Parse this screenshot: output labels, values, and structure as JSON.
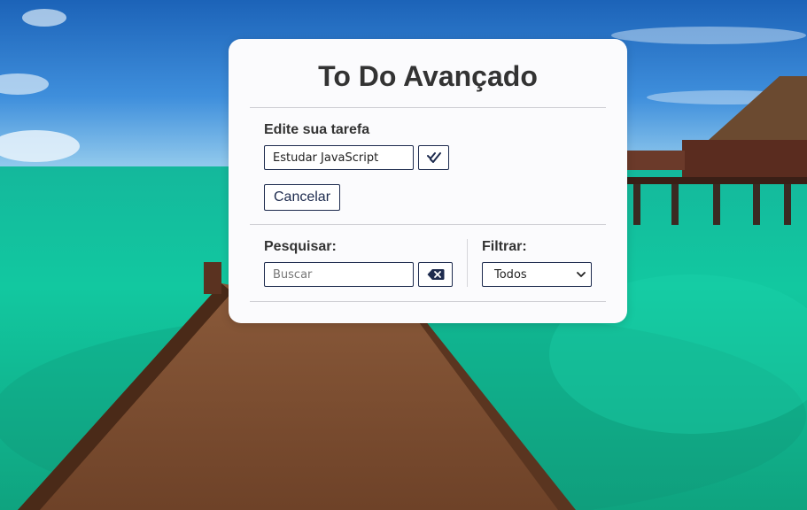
{
  "app": {
    "title": "To Do Avançado"
  },
  "edit": {
    "label": "Edite sua tarefa",
    "input_value": "Estudar JavaScript",
    "confirm_icon": "double-check-icon",
    "cancel_label": "Cancelar"
  },
  "search": {
    "label": "Pesquisar:",
    "placeholder": "Buscar",
    "clear_icon": "backspace-icon"
  },
  "filter": {
    "label": "Filtrar:",
    "selected": "Todos",
    "dropdown_icon": "chevron-down-icon"
  },
  "colors": {
    "accent": "#1d2b4e",
    "card_bg": "#fbfbfd",
    "title_text": "#333333"
  }
}
